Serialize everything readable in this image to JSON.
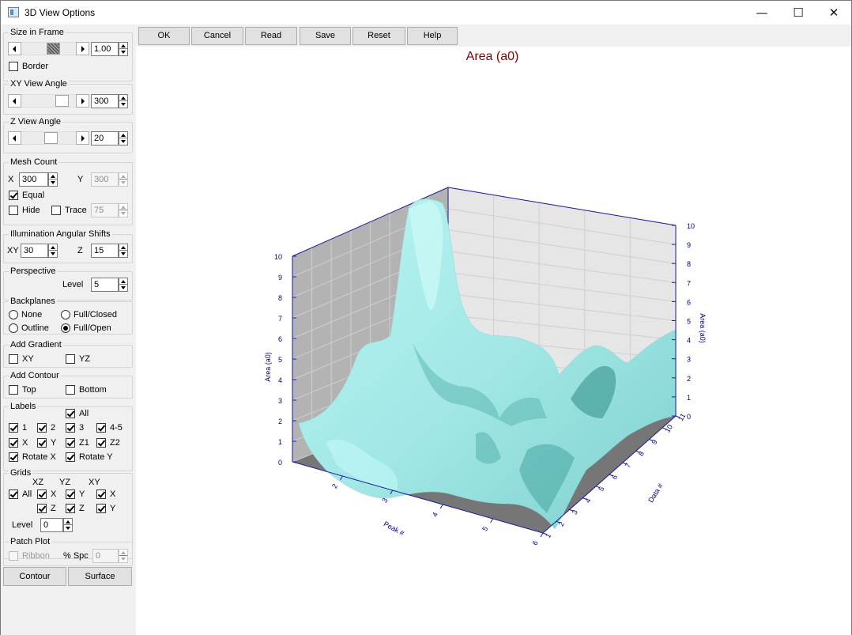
{
  "window": {
    "title": "3D View Options",
    "minimize_glyph": "—",
    "maximize_glyph": "☐",
    "close_glyph": "✕"
  },
  "toolbar": {
    "ok": "OK",
    "cancel": "Cancel",
    "read": "Read",
    "save": "Save",
    "reset": "Reset",
    "help": "Help"
  },
  "size_in_frame": {
    "title": "Size in Frame",
    "value": "1.00",
    "slider_level": 0.62,
    "border_label": "Border",
    "border_checked": false
  },
  "xy_view_angle": {
    "title": "XY View Angle",
    "value": "300",
    "slider_level": 0.83
  },
  "z_view_angle": {
    "title": "Z View Angle",
    "value": "20",
    "slider_level": 0.55
  },
  "mesh_count": {
    "title": "Mesh Count",
    "x_label": "X",
    "x_value": "300",
    "y_label": "Y",
    "y_value": "300",
    "equal_label": "Equal",
    "equal_checked": true,
    "hide_label": "Hide",
    "hide_checked": false,
    "trace_label": "Trace",
    "trace_checked": false,
    "trace_value": "75"
  },
  "illumination": {
    "title": "Illumination Angular Shifts",
    "xy_label": "XY",
    "xy_value": "30",
    "z_label": "Z",
    "z_value": "15"
  },
  "perspective": {
    "title": "Perspective",
    "level_label": "Level",
    "level_value": "5"
  },
  "backplanes": {
    "title": "Backplanes",
    "none": "None",
    "full_closed": "Full/Closed",
    "outline": "Outline",
    "full_open": "Full/Open",
    "selected": "full_open"
  },
  "add_gradient": {
    "title": "Add Gradient",
    "xy": "XY",
    "yz": "YZ"
  },
  "add_contour": {
    "title": "Add Contour",
    "top": "Top",
    "bottom": "Bottom"
  },
  "labels": {
    "title": "Labels",
    "all": "All",
    "l1": "1",
    "l2": "2",
    "l3": "3",
    "l45": "4-5",
    "x": "X",
    "y": "Y",
    "z1": "Z1",
    "z2": "Z2",
    "rotate_x": "Rotate X",
    "rotate_y": "Rotate Y"
  },
  "grids": {
    "title": "Grids",
    "col_xz": "XZ",
    "col_yz": "YZ",
    "col_xy": "XY",
    "all": "All",
    "x": "X",
    "y": "Y",
    "z": "Z",
    "level_label": "Level",
    "level_value": "0"
  },
  "patch_plot": {
    "title": "Patch Plot",
    "ribbon": "Ribbon",
    "spc_label": "% Spc",
    "spc_value": "0"
  },
  "bottom_buttons": {
    "contour": "Contour",
    "surface": "Surface"
  },
  "colors": {
    "surface": "#9ee6e4",
    "surface_shade": "#3e9f9b",
    "title": "#8b0000",
    "axis_text": "#00007a"
  },
  "chart_data": {
    "type": "surface",
    "title": "Area (a0)",
    "xlabel": "Peak #",
    "ylabel": "Data #",
    "zlabel": "Area (a0)",
    "x_ticks": [
      "2",
      "3",
      "4",
      "5",
      "6"
    ],
    "y_ticks": [
      "1",
      "2",
      "3",
      "4",
      "5",
      "6",
      "7",
      "8",
      "9",
      "10",
      "11"
    ],
    "z_ticks": [
      "0",
      "1",
      "2",
      "3",
      "4",
      "5",
      "6",
      "7",
      "8",
      "9",
      "10"
    ],
    "xlim": [
      1,
      6
    ],
    "ylim": [
      1,
      11
    ],
    "zlim": [
      0,
      10
    ],
    "grid": true
  }
}
